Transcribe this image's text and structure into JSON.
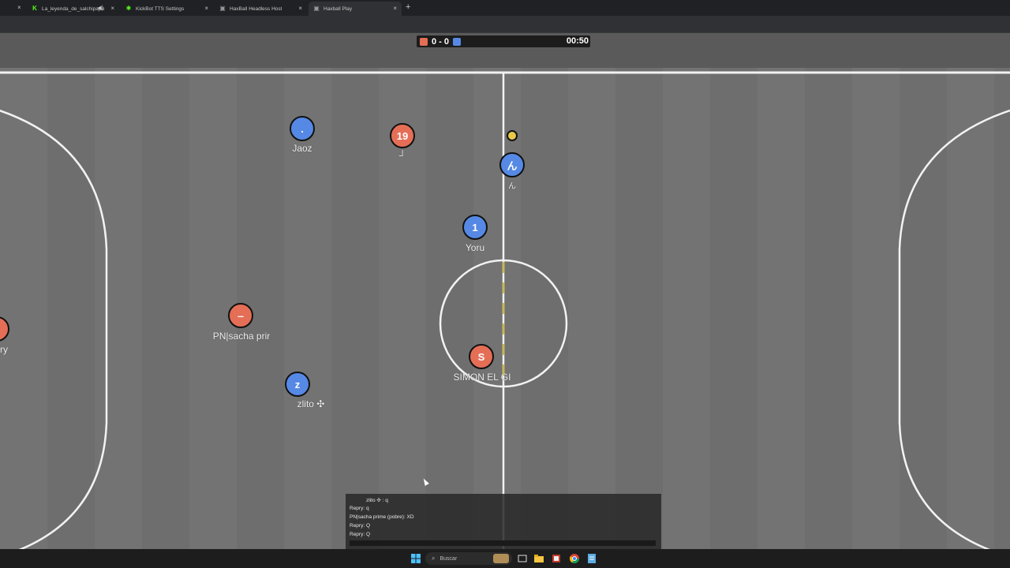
{
  "browser": {
    "tabs": [
      {
        "title": "La_leyenda_de_salchipapu",
        "favicon": "kick-icon",
        "favicon_glyph": "K",
        "favicon_color": "#53fc18",
        "audio": true,
        "active": false
      },
      {
        "title": "KickBot TTS Settings",
        "favicon": "kickbot-icon",
        "favicon_glyph": "✱",
        "favicon_color": "#53fc18",
        "audio": false,
        "active": false
      },
      {
        "title": "HaxBall Headless Host",
        "favicon": "haxball-icon",
        "favicon_glyph": "▣",
        "favicon_color": "#9a9a9a",
        "audio": false,
        "active": false
      },
      {
        "title": "Haxball Play",
        "favicon": "haxball-icon",
        "favicon_glyph": "▣",
        "favicon_color": "#9a9a9a",
        "audio": false,
        "active": true
      }
    ],
    "new_tab_glyph": "+",
    "close_glyph": "×"
  },
  "game": {
    "score": "0 - 0",
    "timer": "00:50",
    "colors": {
      "red": "#e56e56",
      "blue": "#5689e5",
      "ball": "#e8c94a",
      "field": "#717171",
      "lines": "#ffffff",
      "kickoff_line": "#c9b85a"
    },
    "players": [
      {
        "team": "blue",
        "avatar": ".",
        "name": "Jaoz"
      },
      {
        "team": "red",
        "avatar": "19",
        "name": "┘"
      },
      {
        "team": "blue",
        "avatar": "ん",
        "name": "ん"
      },
      {
        "team": "blue",
        "avatar": "1",
        "name": "Yoru"
      },
      {
        "team": "red",
        "avatar": "‒",
        "name": "PN|sacha prir"
      },
      {
        "team": "red",
        "avatar": "S",
        "name": "SIMON EL GI"
      },
      {
        "team": "blue",
        "avatar": "z",
        "name": "zlito ✣"
      },
      {
        "team": "red",
        "avatar": "",
        "name": "ry"
      }
    ]
  },
  "chat": {
    "messages": [
      "zlito ✣ : q",
      "Repry: q",
      "PN|sacha prime (pobre): XD",
      "Repry: Q",
      "Repry: Q"
    ],
    "input_value": ""
  },
  "taskbar": {
    "search_placeholder": "Buscar",
    "icons": [
      "windows-start-icon",
      "search-icon",
      "task-view-icon",
      "file-explorer-icon",
      "app-icon",
      "chrome-icon",
      "notepad-icon"
    ]
  }
}
